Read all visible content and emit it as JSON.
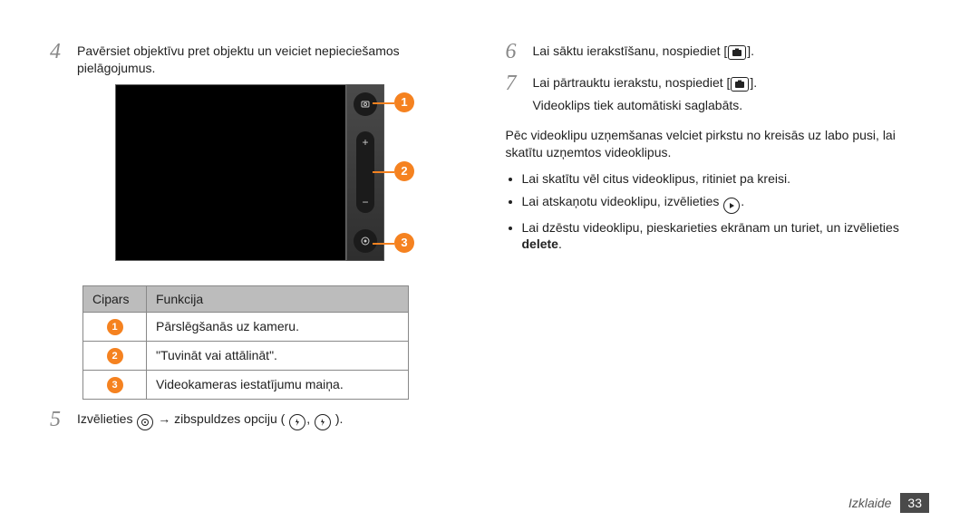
{
  "left": {
    "step4": "Pavērsiet objektīvu pret objektu un veiciet nepieciešamos pielāgojumus.",
    "table": {
      "header_num": "Cipars",
      "header_fn": "Funkcija",
      "rows": [
        {
          "n": "1",
          "fn": "Pārslēgšanās uz kameru."
        },
        {
          "n": "2",
          "fn": "\"Tuvināt vai attālināt\"."
        },
        {
          "n": "3",
          "fn": "Videokameras iestatījumu maiņa."
        }
      ]
    },
    "step5_pre": "Izvēlieties ",
    "step5_mid": " → zibspuldzes opciju (",
    "step5_post": ")."
  },
  "right": {
    "step6_pre": "Lai sāktu ierakstīšanu, nospiediet [",
    "step6_post": "].",
    "step7_pre": "Lai pārtrauktu ierakstu, nospiediet [",
    "step7_post": "].",
    "step7_line2": "Videoklips tiek automātiski saglabāts.",
    "para": "Pēc videoklipu uzņemšanas velciet pirkstu no kreisās uz labo pusi, lai skatītu uzņemtos videoklipus.",
    "bullets": {
      "b1": "Lai skatītu vēl citus videoklipus, ritiniet pa kreisi.",
      "b2_pre": "Lai atskaņotu videoklipu, izvēlieties ",
      "b2_post": ".",
      "b3_pre": "Lai dzēstu videoklipu, pieskarieties ekrānam un turiet, un izvēlieties ",
      "b3_bold": "delete",
      "b3_post": "."
    }
  },
  "footer": {
    "section": "Izklaide",
    "page": "33"
  }
}
